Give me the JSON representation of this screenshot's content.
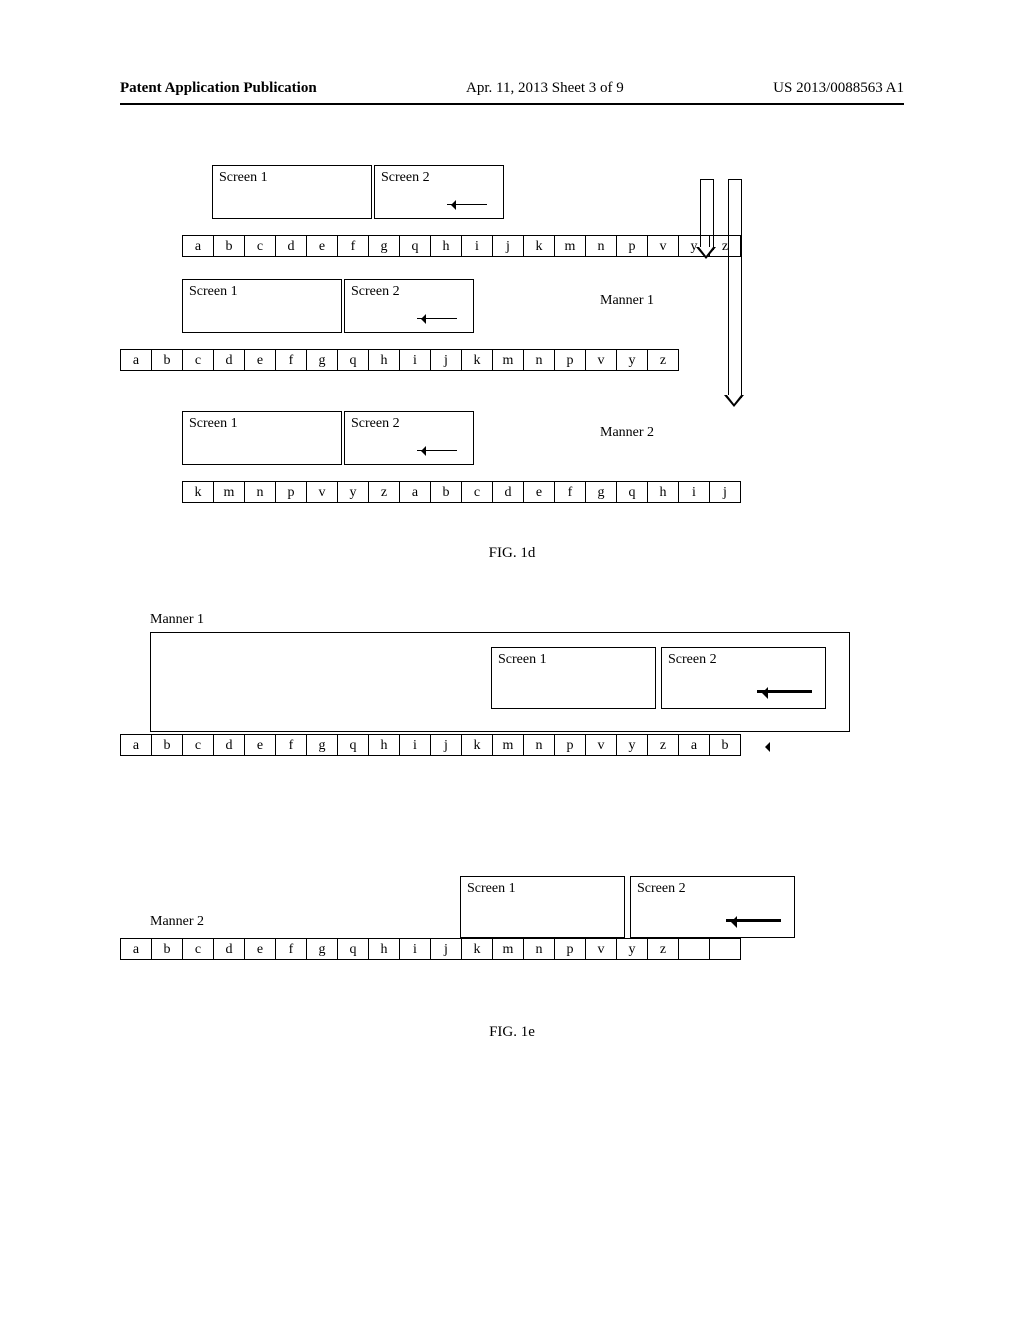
{
  "header": {
    "left": "Patent Application Publication",
    "mid": "Apr. 11, 2013  Sheet 3 of 9",
    "right": "US 2013/0088563 A1"
  },
  "screen1": "Screen 1",
  "screen2": "Screen 2",
  "manner1": "Manner 1",
  "manner2": "Manner 2",
  "fig1d_caption": "FIG. 1d",
  "fig1e_caption": "FIG. 1e",
  "fig1d": {
    "row0": [
      "a",
      "b",
      "c",
      "d",
      "e",
      "f",
      "g",
      "q",
      "h",
      "i",
      "j",
      "k",
      "m",
      "n",
      "p",
      "v",
      "y",
      "z"
    ],
    "row1": [
      "a",
      "b",
      "c",
      "d",
      "e",
      "f",
      "g",
      "q",
      "h",
      "i",
      "j",
      "k",
      "m",
      "n",
      "p",
      "v",
      "y",
      "z"
    ],
    "row2": [
      "k",
      "m",
      "n",
      "p",
      "v",
      "y",
      "z",
      "a",
      "b",
      "c",
      "d",
      "e",
      "f",
      "g",
      "q",
      "h",
      "i",
      "j"
    ]
  },
  "fig1e": {
    "row_m1": [
      "a",
      "b",
      "c",
      "d",
      "e",
      "f",
      "g",
      "q",
      "h",
      "i",
      "j",
      "k",
      "m",
      "n",
      "p",
      "v",
      "y",
      "z",
      "a",
      "b"
    ],
    "row_m2": [
      "a",
      "b",
      "c",
      "d",
      "e",
      "f",
      "g",
      "q",
      "h",
      "i",
      "j",
      "k",
      "m",
      "n",
      "p",
      "v",
      "y",
      "z",
      "",
      ""
    ]
  }
}
